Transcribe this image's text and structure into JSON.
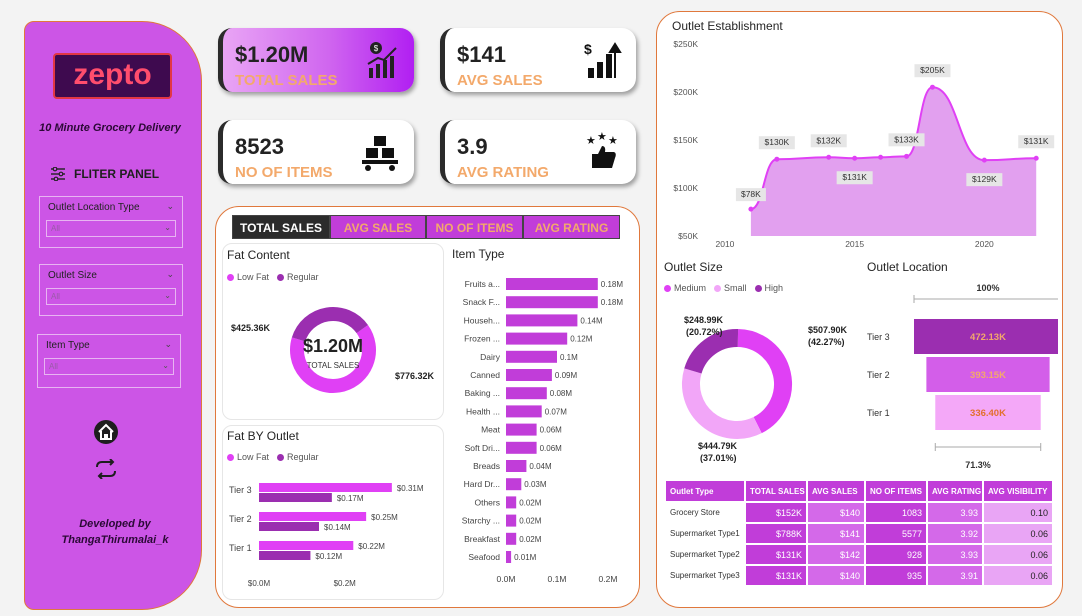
{
  "sidebar": {
    "logo": "zepto",
    "tagline": "10 Minute Grocery Delivery",
    "filter_title": "FLITER PANEL",
    "slicers": [
      {
        "label": "Outlet Location Type",
        "value": "All"
      },
      {
        "label": "Outlet Size",
        "value": "All"
      },
      {
        "label": "Item Type",
        "value": "All"
      }
    ],
    "developer_line1": "Developed by",
    "developer_line2": "ThangaThirumalai_k"
  },
  "kpis": [
    {
      "value": "$1.20M",
      "label": "TOTAL SALES",
      "icon": "sales-chart-icon"
    },
    {
      "value": "$141",
      "label": "AVG SALES",
      "icon": "growth-chart-icon"
    },
    {
      "value": "8523",
      "label": "NO OF ITEMS",
      "icon": "boxes-icon"
    },
    {
      "value": "3.9",
      "label": "AVG RATING",
      "icon": "thumbs-up-stars-icon"
    }
  ],
  "tabs": [
    "TOTAL SALES",
    "AVG SALES",
    "NO OF ITEMS",
    "AVG RATING"
  ],
  "colors": {
    "primary": "#c13dd9",
    "light": "#e9a5f5",
    "dark": "#9b2eb0",
    "accent_orange": "#f3a96b",
    "border": "#e0783c"
  },
  "chart_data": [
    {
      "id": "fat-content",
      "type": "pie",
      "title": "Fat Content",
      "series": [
        {
          "name": "Low Fat",
          "value": 776.32,
          "label": "$776.32K"
        },
        {
          "name": "Regular",
          "value": 425.36,
          "label": "$425.36K"
        }
      ],
      "center_value": "$1.20M",
      "center_label": "TOTAL SALES"
    },
    {
      "id": "fat-by-outlet",
      "type": "bar",
      "title": "Fat BY Outlet",
      "categories": [
        "Tier 3",
        "Tier 2",
        "Tier 1"
      ],
      "series": [
        {
          "name": "Low Fat",
          "values": [
            0.31,
            0.25,
            0.22
          ],
          "labels": [
            "$0.31M",
            "$0.25M",
            "$0.22M"
          ]
        },
        {
          "name": "Regular",
          "values": [
            0.17,
            0.14,
            0.12
          ],
          "labels": [
            "$0.17M",
            "$0.14M",
            "$0.12M"
          ]
        }
      ],
      "xticks": [
        "$0.0M",
        "$0.2M"
      ],
      "xlim": [
        0,
        0.35
      ]
    },
    {
      "id": "item-type",
      "type": "bar",
      "title": "Item Type",
      "categories": [
        "Fruits a...",
        "Snack F...",
        "Househ...",
        "Frozen ...",
        "Dairy",
        "Canned",
        "Baking ...",
        "Health ...",
        "Meat",
        "Soft Dri...",
        "Breads",
        "Hard Dr...",
        "Others",
        "Starchy ...",
        "Breakfast",
        "Seafood"
      ],
      "values": [
        0.18,
        0.18,
        0.14,
        0.12,
        0.1,
        0.09,
        0.08,
        0.07,
        0.06,
        0.06,
        0.04,
        0.03,
        0.02,
        0.02,
        0.02,
        0.01
      ],
      "labels": [
        "0.18M",
        "0.18M",
        "0.14M",
        "0.12M",
        "0.1M",
        "0.09M",
        "0.08M",
        "0.07M",
        "0.06M",
        "0.06M",
        "0.04M",
        "0.03M",
        "0.02M",
        "0.02M",
        "0.02M",
        "0.01M"
      ],
      "xticks": [
        "0.0M",
        "0.1M",
        "0.2M"
      ],
      "xlim": [
        0,
        0.2
      ]
    },
    {
      "id": "outlet-establishment",
      "type": "area",
      "title": "Outlet Establishment",
      "x": [
        2011,
        2012,
        2014,
        2015,
        2016,
        2017,
        2018,
        2020,
        2022
      ],
      "values": [
        78,
        130,
        132,
        131,
        132,
        133,
        205,
        129,
        131
      ],
      "labels": [
        "$78K",
        "$130K",
        "$132K",
        "$131K",
        "",
        "$133K",
        "$205K",
        "$129K",
        "$131K"
      ],
      "yticks": [
        "$50K",
        "$100K",
        "$150K",
        "$200K",
        "$250K"
      ],
      "xticks": [
        "2010",
        "2015",
        "2020"
      ],
      "ylim": [
        50,
        250
      ]
    },
    {
      "id": "outlet-size",
      "type": "pie",
      "title": "Outlet Size",
      "series": [
        {
          "name": "Medium",
          "value": 507.9,
          "label": "$507.90K",
          "pct": "(42.27%)"
        },
        {
          "name": "Small",
          "value": 444.79,
          "label": "$444.79K",
          "pct": "(37.01%)"
        },
        {
          "name": "High",
          "value": 248.99,
          "label": "$248.99K",
          "pct": "(20.72%)"
        }
      ]
    },
    {
      "id": "outlet-location",
      "type": "bar",
      "title": "Outlet Location",
      "categories": [
        "Tier 3",
        "Tier 2",
        "Tier 1"
      ],
      "values": [
        472.13,
        393.15,
        336.4
      ],
      "labels": [
        "472.13K",
        "393.15K",
        "336.40K"
      ],
      "top_pct": "100%",
      "bottom_pct": "71.3%"
    },
    {
      "id": "outlet-type-table",
      "type": "table",
      "columns": [
        "Outlet Type",
        "TOTAL SALES",
        "AVG SALES",
        "NO OF ITEMS",
        "AVG RATING",
        "AVG VISIBILITY"
      ],
      "rows": [
        [
          "Grocery Store",
          "$152K",
          "$140",
          "1083",
          "3.93",
          "0.10"
        ],
        [
          "Supermarket Type1",
          "$788K",
          "$141",
          "5577",
          "3.92",
          "0.06"
        ],
        [
          "Supermarket Type2",
          "$131K",
          "$142",
          "928",
          "3.93",
          "0.06"
        ],
        [
          "Supermarket Type3",
          "$131K",
          "$140",
          "935",
          "3.91",
          "0.06"
        ]
      ]
    }
  ]
}
